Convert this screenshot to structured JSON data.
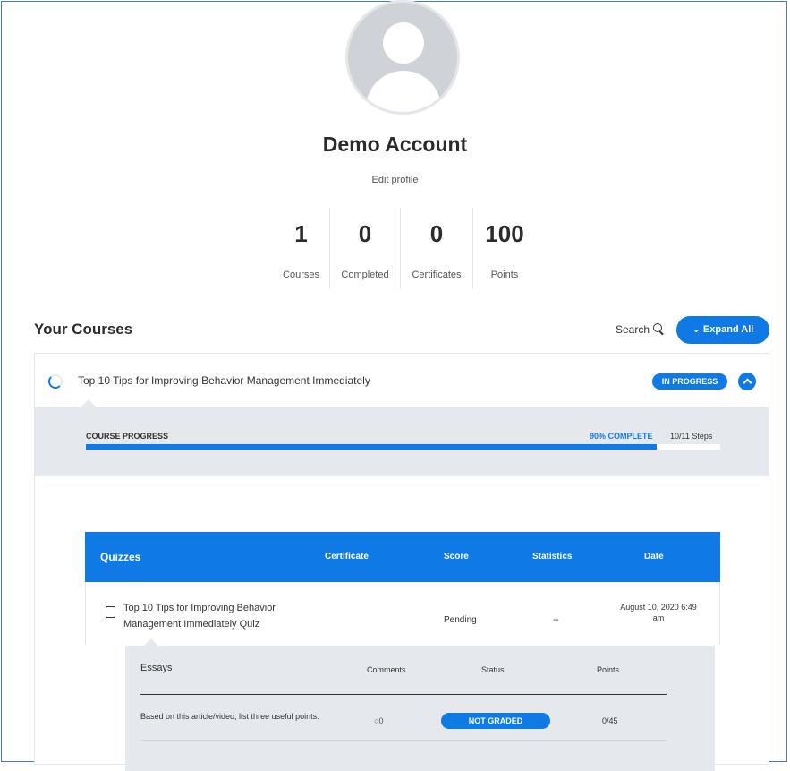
{
  "profile": {
    "name": "Demo Account",
    "edit_label": "Edit profile",
    "stats": [
      {
        "value": "1",
        "label": "Courses"
      },
      {
        "value": "0",
        "label": "Completed"
      },
      {
        "value": "0",
        "label": "Certificates"
      },
      {
        "value": "100",
        "label": "Points"
      }
    ]
  },
  "courses_section": {
    "title": "Your Courses",
    "search_label": "Search",
    "expand_label": "Expand All"
  },
  "course": {
    "title": "Top 10 Tips for Improving Behavior Management Immediately",
    "status_badge": "IN PROGRESS",
    "progress_label": "COURSE PROGRESS",
    "progress_text": "90% COMPLETE",
    "progress_fraction": 0.9,
    "steps_text": "10/11 Steps"
  },
  "quizzes": {
    "headers": {
      "title": "Quizzes",
      "certificate": "Certificate",
      "score": "Score",
      "statistics": "Statistics",
      "date": "Date"
    },
    "row": {
      "name": "Top 10 Tips for Improving Behavior Management Immediately Quiz",
      "score": "Pending",
      "statistics": "--",
      "date": "August 10, 2020 6:49 am"
    }
  },
  "essays": {
    "headers": {
      "title": "Essays",
      "comments": "Comments",
      "status": "Status",
      "points": "Points"
    },
    "row": {
      "prompt": "Based on this article/video, list three useful points.",
      "comments": "0",
      "status": "NOT GRADED",
      "points": "0/45"
    }
  },
  "colors": {
    "accent": "#0f7ae5",
    "panel": "#e5e9ee"
  }
}
